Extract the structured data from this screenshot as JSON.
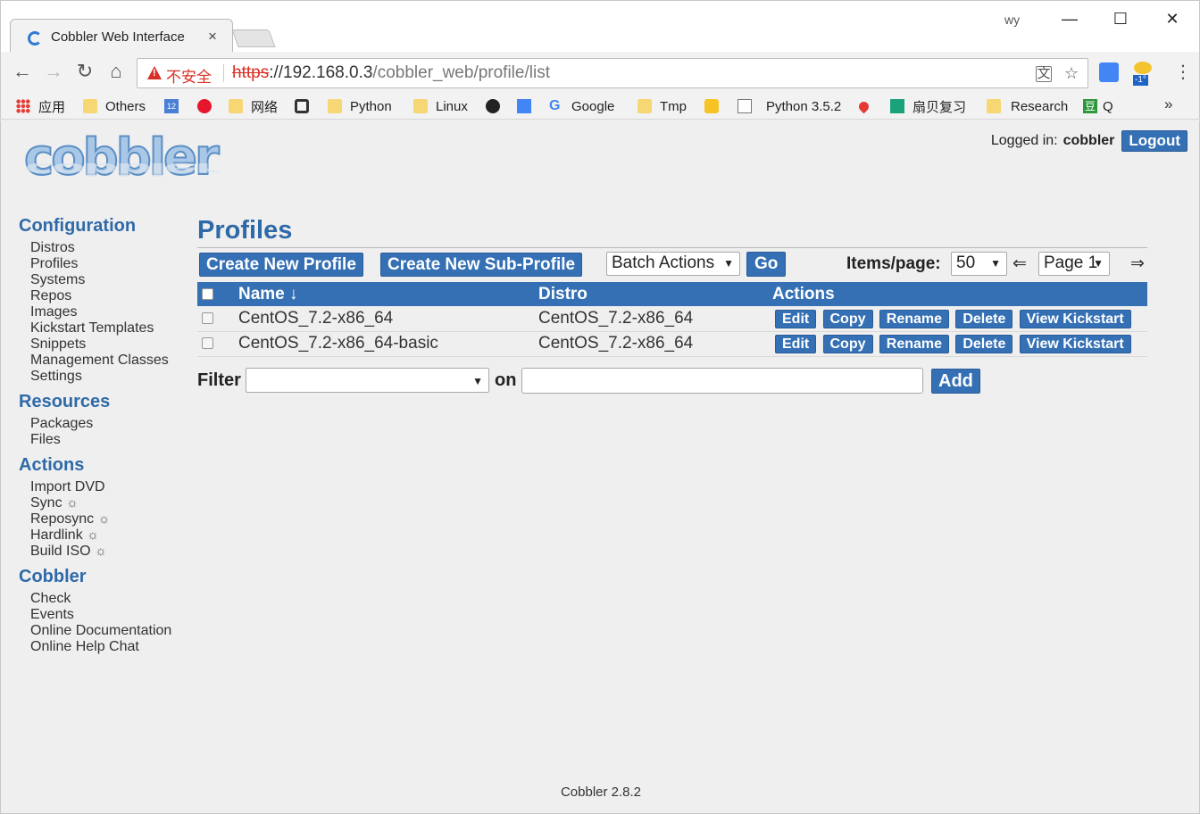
{
  "browser": {
    "tab_title": "Cobbler Web Interface",
    "tab_close": "×",
    "window_user": "wy",
    "window_controls": [
      "—",
      "☐",
      "✕"
    ],
    "security_label": "不安全",
    "url_scheme": "https",
    "url_host": "://192.168.0.3",
    "url_path": "/cobbler_web/profile/list",
    "menu_glyph": "⋮",
    "bookmarks": [
      {
        "label": "应用",
        "icon": "apps-icon"
      },
      {
        "label": "Others",
        "icon": "folder-icon"
      },
      {
        "label": "",
        "icon": "calendar-icon"
      },
      {
        "label": "",
        "icon": "weibo-icon"
      },
      {
        "label": "网络",
        "icon": "folder-icon"
      },
      {
        "label": "",
        "icon": "link-icon"
      },
      {
        "label": "Python",
        "icon": "folder-icon"
      },
      {
        "label": "Linux",
        "icon": "folder-icon"
      },
      {
        "label": "",
        "icon": "github-icon"
      },
      {
        "label": "",
        "icon": "translate-icon"
      },
      {
        "label": "Google",
        "icon": "google-icon"
      },
      {
        "label": "Tmp",
        "icon": "folder-icon"
      },
      {
        "label": "",
        "icon": "bulb-icon"
      },
      {
        "label": "Python 3.5.2",
        "icon": "page-icon"
      },
      {
        "label": "",
        "icon": "maps-icon"
      },
      {
        "label": "扇贝复习",
        "icon": "shanbay-icon"
      },
      {
        "label": "Research",
        "icon": "folder-icon"
      },
      {
        "label": "Q",
        "icon": "douban-icon"
      }
    ],
    "bookmarks_more": "»",
    "weather_badge": "-1°"
  },
  "header": {
    "logo_text": "cobbler",
    "logged_in_label": "Logged in:",
    "username": "cobbler",
    "logout_label": "Logout"
  },
  "sidebar": {
    "sections": [
      {
        "heading": "Configuration",
        "items": [
          "Distros",
          "Profiles",
          "Systems",
          "Repos",
          "Images",
          "Kickstart Templates",
          "Snippets",
          "Management Classes",
          "Settings"
        ]
      },
      {
        "heading": "Resources",
        "items": [
          "Packages",
          "Files"
        ]
      },
      {
        "heading": "Actions",
        "items": [
          "Import DVD",
          "Sync",
          "Reposync",
          "Hardlink",
          "Build ISO"
        ]
      },
      {
        "heading": "Cobbler",
        "items": [
          "Check",
          "Events",
          "Online Documentation",
          "Online Help Chat"
        ]
      }
    ],
    "task_glyph": "☼"
  },
  "main": {
    "title": "Profiles",
    "create_profile_label": "Create New Profile",
    "create_subprofile_label": "Create New Sub-Profile",
    "batch_actions_label": "Batch Actions",
    "go_label": "Go",
    "items_per_page_label": "Items/page:",
    "items_per_page_value": "50",
    "prev_arrow": "⇐",
    "page_value": "Page 1",
    "next_arrow": "⇒",
    "columns": [
      "Name ↓",
      "Distro",
      "Actions"
    ],
    "rows": [
      {
        "name": "CentOS_7.2-x86_64",
        "distro": "CentOS_7.2-x86_64"
      },
      {
        "name": "CentOS_7.2-x86_64-basic",
        "distro": "CentOS_7.2-x86_64"
      }
    ],
    "row_actions": [
      "Edit",
      "Copy",
      "Rename",
      "Delete",
      "View Kickstart"
    ],
    "filter_label": "Filter",
    "filter_on_label": "on",
    "filter_value": "",
    "add_label": "Add"
  },
  "footer": {
    "version": "Cobbler 2.8.2"
  },
  "colors": {
    "accent": "#3570b4",
    "heading": "#2f6aa8",
    "insecure": "#d93025"
  }
}
